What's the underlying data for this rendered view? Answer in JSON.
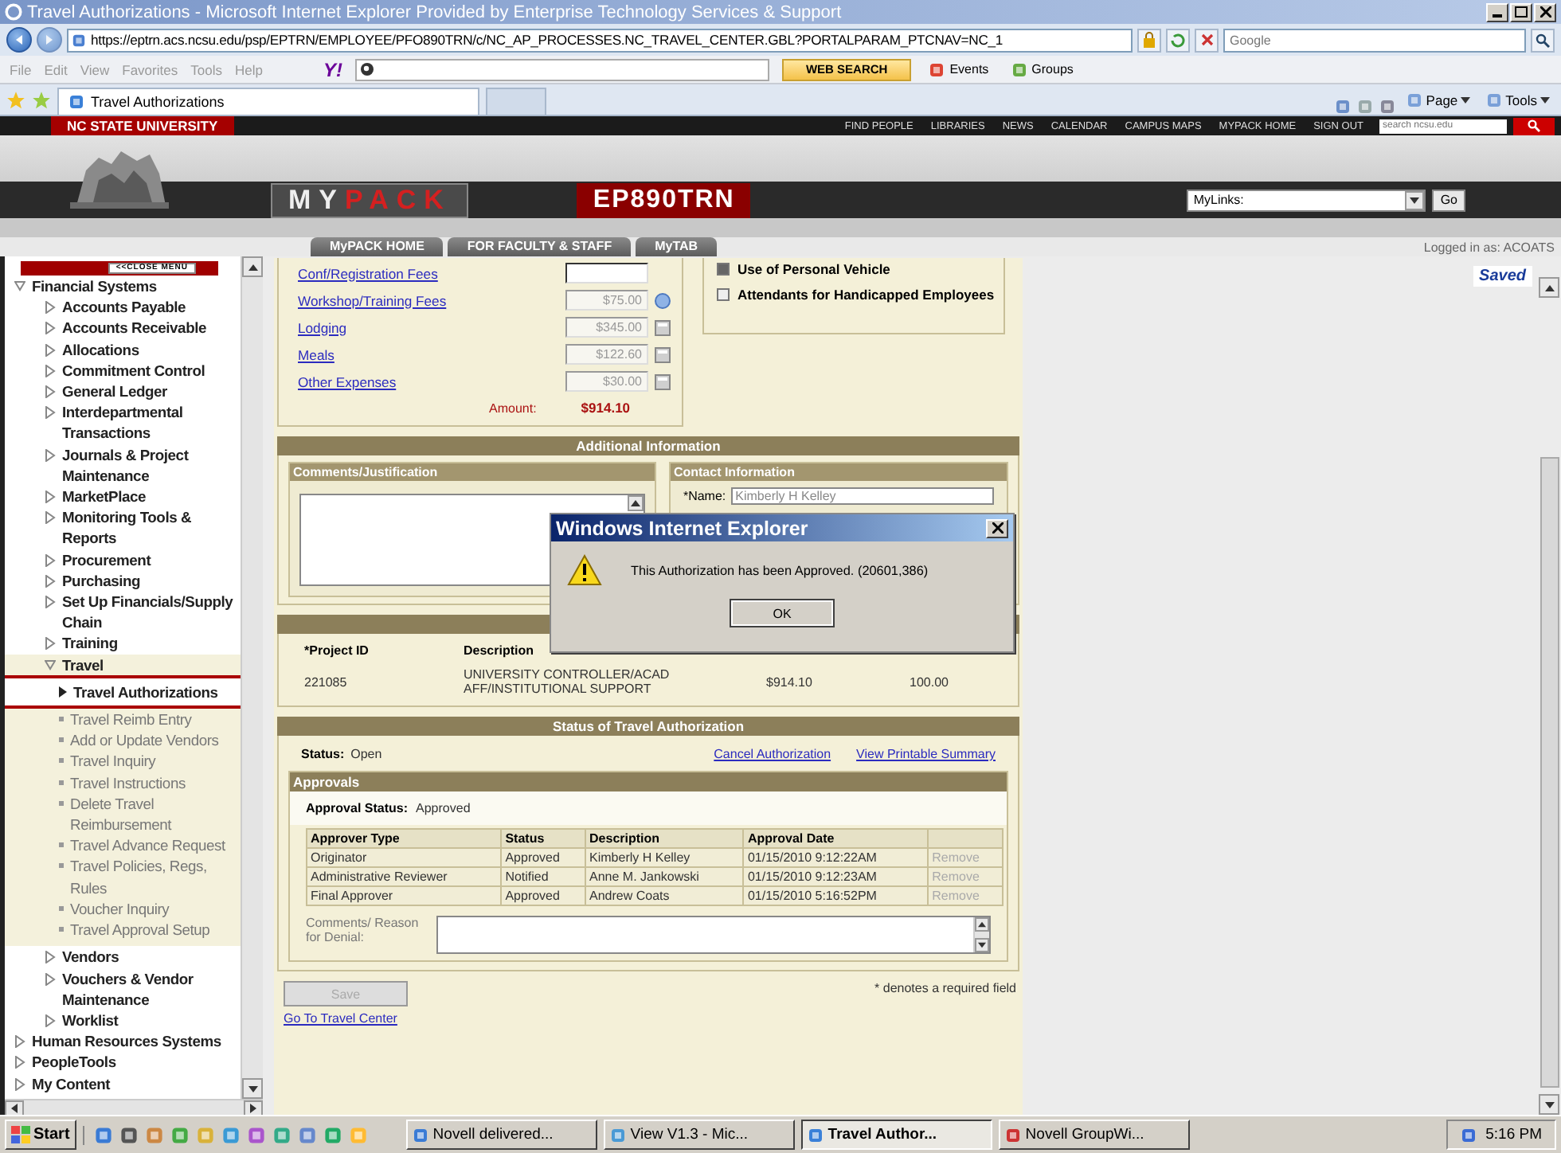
{
  "window": {
    "title": "Travel Authorizations - Microsoft Internet Explorer Provided by Enterprise Technology Services & Support"
  },
  "address": "https://eptrn.acs.ncsu.edu/psp/EPTRN/EMPLOYEE/PFO890TRN/c/NC_AP_PROCESSES.NC_TRAVEL_CENTER.GBL?PORTALPARAM_PTCNAV=NC_1",
  "search_engine": {
    "placeholder": "Google"
  },
  "menu": [
    "File",
    "Edit",
    "View",
    "Favorites",
    "Tools",
    "Help"
  ],
  "toolbar": {
    "logo": "Y!",
    "web_search": "WEB SEARCH",
    "events": "Events",
    "groups": "Groups"
  },
  "browser_tabs": [
    {
      "label": "Travel Authorizations",
      "selected": true
    }
  ],
  "command_bar": [
    "Page",
    "Tools"
  ],
  "university_bar": {
    "name": "NC STATE UNIVERSITY",
    "links": [
      "FIND PEOPLE",
      "LIBRARIES",
      "NEWS",
      "CALENDAR",
      "CAMPUS MAPS",
      "MYPACK HOME",
      "SIGN OUT"
    ],
    "search_placeholder": "search ncsu.edu"
  },
  "header": {
    "brand_left": "MY",
    "brand_right": "PACK",
    "page_code": "EP890TRN",
    "links_select": "MyLinks:",
    "go": "Go"
  },
  "nav_tabs": [
    "MyPACK HOME",
    "FOR FACULTY & STAFF",
    "MyTAB"
  ],
  "logged_in": "Logged in as: ACOATS",
  "saved": "Saved",
  "sidebar": {
    "close_button": "<<CLOSE MENU",
    "items": [
      {
        "label": "Financial Systems",
        "expanded": true,
        "children": [
          {
            "label": "Accounts Payable",
            "expanded": false
          },
          {
            "label": "Accounts Receivable",
            "expanded": false
          },
          {
            "label": "Allocations",
            "expanded": false
          },
          {
            "label": "Commitment Control",
            "expanded": false
          },
          {
            "label": "General Ledger",
            "expanded": false
          },
          {
            "label": "Interdepartmental Transactions",
            "expanded": false
          },
          {
            "label": "Journals & Project Maintenance",
            "expanded": false
          },
          {
            "label": "MarketPlace",
            "expanded": false
          },
          {
            "label": "Monitoring Tools & Reports",
            "expanded": false
          },
          {
            "label": "Procurement",
            "expanded": false
          },
          {
            "label": "Purchasing",
            "expanded": false
          },
          {
            "label": "Set Up Financials/Supply Chain",
            "expanded": false
          },
          {
            "label": "Training",
            "expanded": false
          },
          {
            "label": "Travel",
            "expanded": true,
            "children": [
              {
                "label": "Travel Authorizations",
                "selected": true
              },
              {
                "label": "Travel Reimb Entry",
                "selected": false
              },
              {
                "label": "Add or Update Vendors",
                "selected": false
              },
              {
                "label": "Travel Inquiry",
                "selected": false
              },
              {
                "label": "Travel Instructions",
                "selected": false
              },
              {
                "label": "Delete Travel Reimbursement",
                "selected": false
              },
              {
                "label": "Travel Advance Request",
                "selected": false
              },
              {
                "label": "Travel Policies, Regs, Rules",
                "selected": false
              },
              {
                "label": "Voucher Inquiry",
                "selected": false
              },
              {
                "label": "Travel Approval Setup",
                "selected": false
              }
            ]
          },
          {
            "label": "Vendors",
            "expanded": false
          },
          {
            "label": "Vouchers & Vendor Maintenance",
            "expanded": false
          },
          {
            "label": "Worklist",
            "expanded": false
          }
        ]
      },
      {
        "label": "Human Resources Systems",
        "expanded": false
      },
      {
        "label": "PeopleTools",
        "expanded": false
      },
      {
        "label": "My Content",
        "expanded": false
      }
    ]
  },
  "expenses": [
    {
      "label": "Conf/Registration Fees",
      "kind": "blank",
      "disabled": false
    },
    {
      "label": "Workshop/Training Fees",
      "value": "$75.00",
      "kind": "info",
      "disabled": true
    },
    {
      "label": "Lodging",
      "value": "$345.00",
      "kind": "lookup",
      "disabled": true
    },
    {
      "label": "Meals",
      "value": "$122.60",
      "kind": "lookup",
      "disabled": true
    },
    {
      "label": "Other Expenses",
      "value": "$30.00",
      "kind": "lookup",
      "disabled": true
    }
  ],
  "amount": {
    "label": "Amount:",
    "value": "$914.10"
  },
  "options": [
    {
      "label": "Use of Personal Vehicle",
      "checked": true
    },
    {
      "label": "Attendants for Handicapped Employees",
      "checked": false
    }
  ],
  "additional": {
    "title": "Additional Information",
    "comments_title": "Comments/Justification",
    "contact_title": "Contact Information",
    "name_label": "*Name:",
    "name_value": "Kimberly H Kelley"
  },
  "project": {
    "columns": [
      "*Project ID",
      "Description"
    ],
    "row": [
      "221085",
      "UNIVERSITY CONTROLLER/ACAD AFF/INSTITUTIONAL SUPPORT",
      "$914.10",
      "100.00"
    ]
  },
  "status": {
    "title": "Status of Travel Authorization",
    "label": "Status:",
    "value": "Open",
    "links": [
      "Cancel Authorization",
      "View Printable Summary"
    ],
    "approvals_title": "Approvals",
    "approval_status_label": "Approval Status:",
    "approval_status": "Approved",
    "columns": [
      "Approver Type",
      "Status",
      "Description",
      "Approval Date"
    ],
    "rows": [
      {
        "cells": [
          "Originator",
          "Approved",
          "Kimberly H Kelley",
          "01/15/2010  9:12:22AM"
        ],
        "action": "Remove",
        "action_disabled": true
      },
      {
        "cells": [
          "Administrative Reviewer",
          "Notified",
          "Anne M. Jankowski",
          "01/15/2010  9:12:23AM"
        ],
        "action": "Remove",
        "action_disabled": true
      },
      {
        "cells": [
          "Final Approver",
          "Approved",
          "Andrew Coats",
          "01/15/2010  5:16:52PM"
        ],
        "action": "Remove",
        "action_disabled": true
      }
    ],
    "comments_label": "Comments/ Reason for Denial:"
  },
  "footer": {
    "save": "Save",
    "save_disabled": true,
    "note": "* denotes a required field",
    "link": "Go To Travel Center"
  },
  "dialog": {
    "title": "Windows Internet Explorer",
    "message": "This Authorization has been Approved. (20601,386)",
    "ok": "OK"
  },
  "taskbar": {
    "start": "Start",
    "tasks": [
      {
        "label": "Novell delivered...",
        "selected": false
      },
      {
        "label": "View V1.3 - Mic...",
        "selected": false
      },
      {
        "label": "Travel Author...",
        "selected": true
      },
      {
        "label": "Novell GroupWi...",
        "selected": false
      }
    ],
    "clock": "5:16 PM"
  }
}
